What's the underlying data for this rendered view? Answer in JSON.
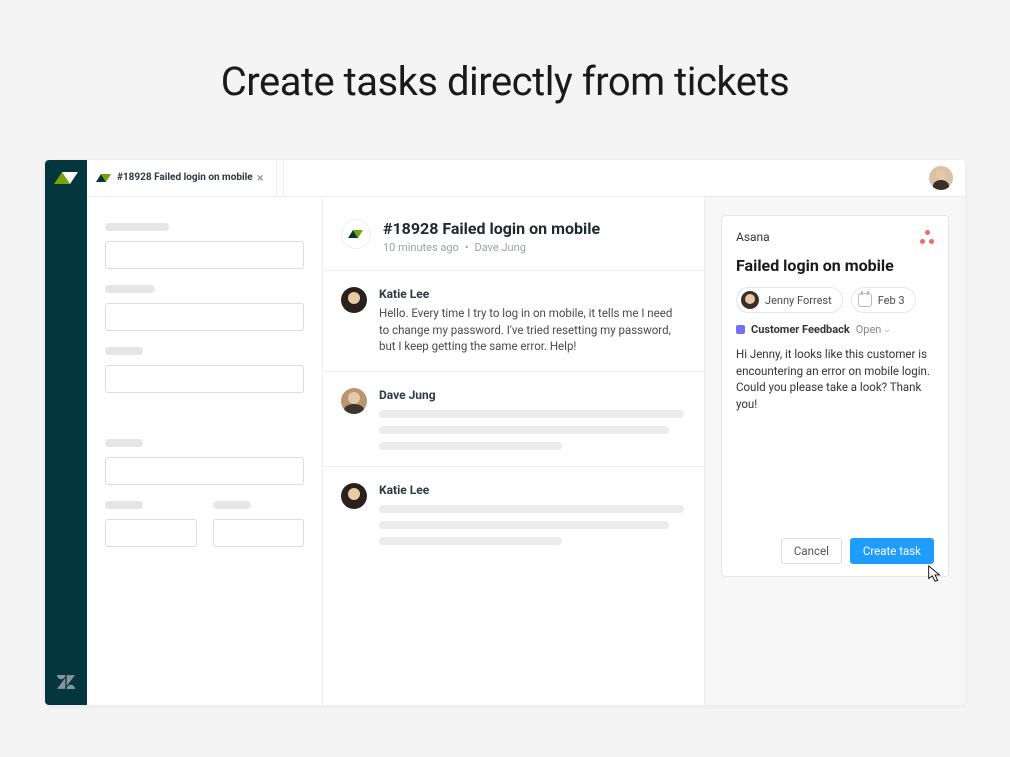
{
  "page_heading": "Create tasks directly from tickets",
  "tab": {
    "title": "#18928 Failed login on mobile"
  },
  "ticket": {
    "title": "#18928 Failed login on mobile",
    "time": "10 minutes ago",
    "author": "Dave Jung"
  },
  "messages": [
    {
      "author": "Katie Lee",
      "text": "Hello. Every time I try to log in on mobile, it tells me I need to change my password. I've tried resetting my password, but I keep getting the same error. Help!"
    },
    {
      "author": "Dave Jung",
      "text": ""
    },
    {
      "author": "Katie Lee",
      "text": ""
    }
  ],
  "asana": {
    "label": "Asana",
    "task_title": "Failed login on mobile",
    "assignee": "Jenny Forrest",
    "due_date": "Feb 3",
    "project": "Customer Feedback",
    "status": "Open",
    "description": "Hi Jenny, it looks like this customer is encountering an error on mobile login. Could you please take a look? Thank you!",
    "cancel": "Cancel",
    "create": "Create task"
  }
}
